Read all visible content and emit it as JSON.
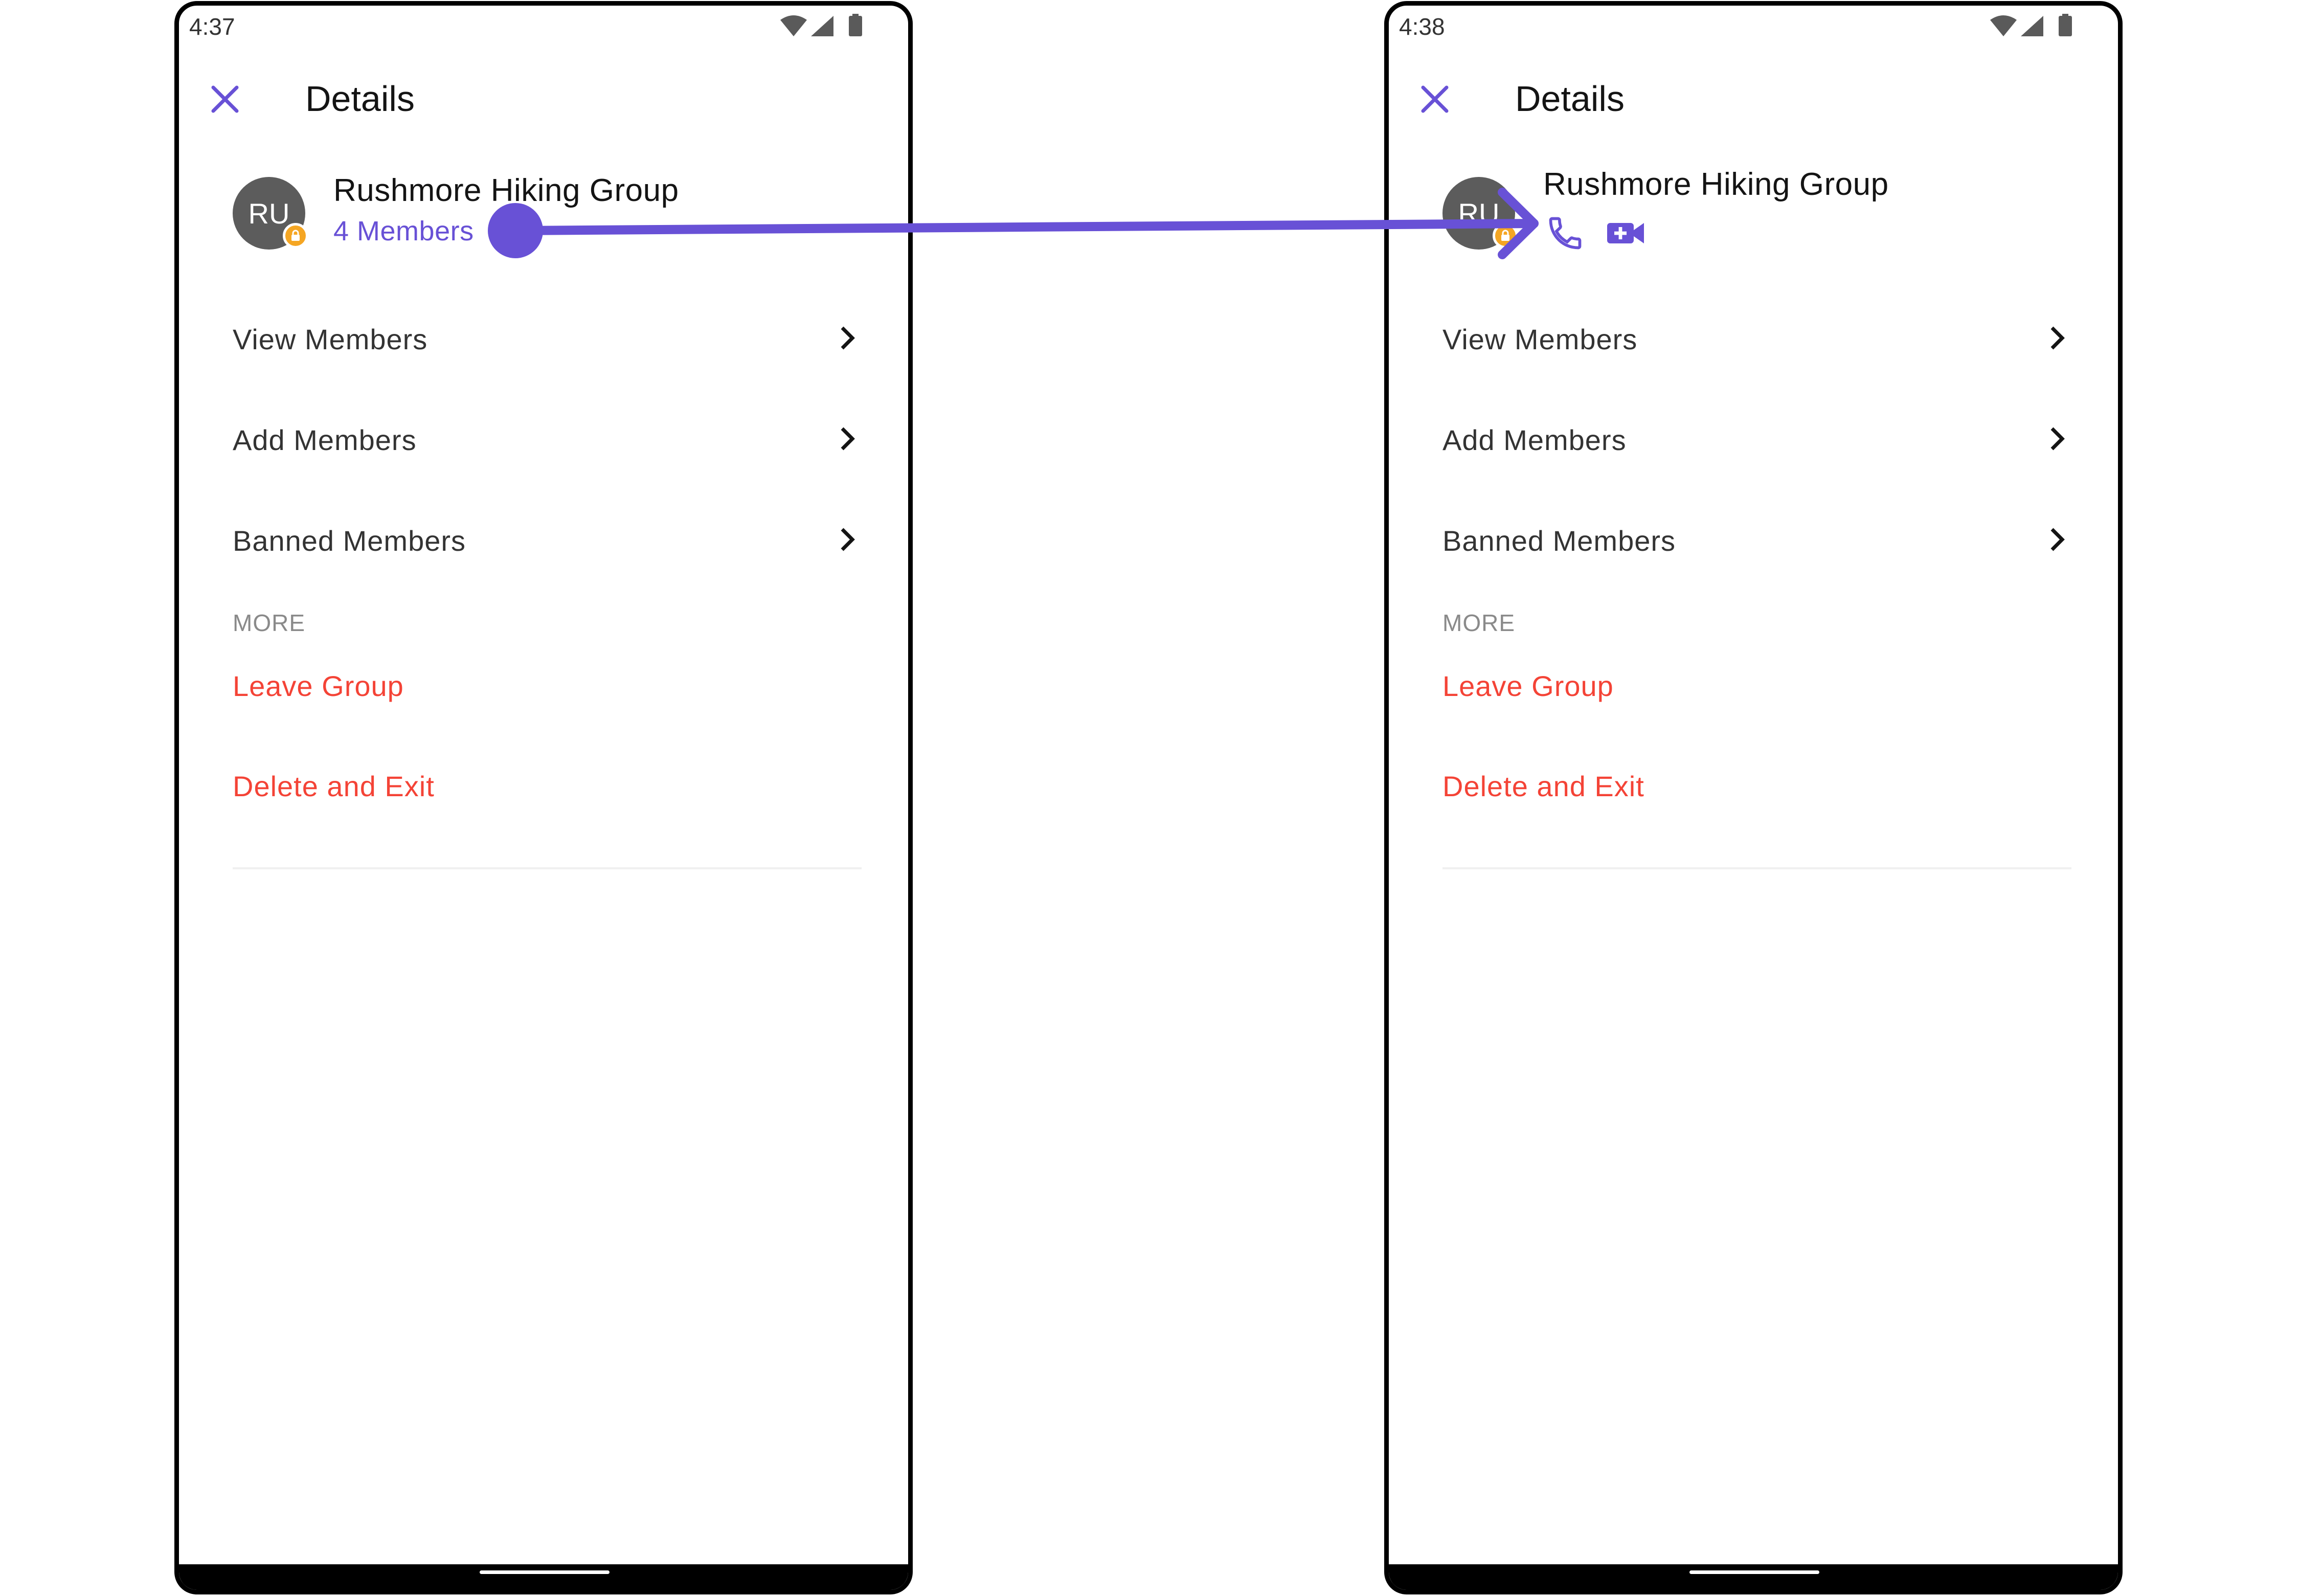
{
  "screens": [
    {
      "status_time": "4:37",
      "title": "Details",
      "group": {
        "initials": "RU",
        "name": "Rushmore Hiking Group",
        "members": "4 Members"
      },
      "menu": {
        "view_members": "View Members",
        "add_members": "Add Members",
        "banned_members": "Banned Members"
      },
      "section_more": "MORE",
      "actions": {
        "leave_group": "Leave Group",
        "delete_and_exit": "Delete and Exit"
      }
    },
    {
      "status_time": "4:38",
      "title": "Details",
      "group": {
        "initials": "RU",
        "name": "Rushmore Hiking Group"
      },
      "call_icons": [
        "phone-icon",
        "video-camera-icon"
      ],
      "menu": {
        "view_members": "View Members",
        "add_members": "Add Members",
        "banned_members": "Banned Members"
      },
      "section_more": "MORE",
      "actions": {
        "leave_group": "Leave Group",
        "delete_and_exit": "Delete and Exit"
      }
    }
  ],
  "colors": {
    "accent": "#6851d6",
    "danger": "#f44336",
    "avatar_bg": "#5c5c5c",
    "badge": "#f5a623",
    "annotation": "#6851d6"
  }
}
